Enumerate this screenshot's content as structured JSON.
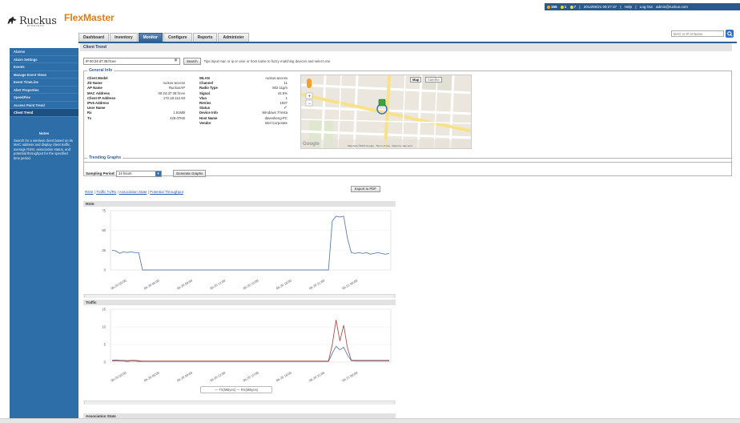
{
  "topbar": {
    "alarm_counts": [
      "155",
      "1",
      "7"
    ],
    "datetime": "2013/06/21 09:27:37",
    "help": "Help",
    "logout": "Log Out",
    "user": "admin@ruckus.com"
  },
  "brand": {
    "logo": "Ruckus",
    "logo_sub": "WIRELESS",
    "product": "FlexMaster"
  },
  "tabs": [
    "Dashboard",
    "Inventory",
    "Monitor",
    "Configure",
    "Reports",
    "Administer"
  ],
  "global_search": {
    "placeholder": "MAC or IP or Name"
  },
  "sidebar": {
    "items": [
      "Alarms",
      "Alarm Settings",
      "Events",
      "Manage Event Views",
      "Event TimeLine",
      "Alert Properties",
      "SpeedFlex",
      "Access Point Trend",
      "Client Trend"
    ],
    "notes_title": "Notes",
    "notes_text": "Search for a wireless client based on its MAC address and display client traffic, average RSSI, association status, and potential throughput for the specified time period."
  },
  "client_trend": {
    "title": "Client Trend",
    "search_value": "IP 00:24:d7:35:f4:ee",
    "search_button": "Search",
    "tips": "Tips:input mac or ip or user or host name to fuzzy matching devices and select one"
  },
  "general_info": {
    "legend": "General Info",
    "left": [
      {
        "k": "Client Model",
        "v": ""
      },
      {
        "k": "ZD Name",
        "v": "ruckus-access"
      },
      {
        "k": "AP Name",
        "v": "RuckusAP"
      },
      {
        "k": "MAC Address",
        "v": "00:24:d7:35:f4:ee"
      },
      {
        "k": "Client IP Address",
        "v": "172.18.112.93"
      },
      {
        "k": "IPv6 Address",
        "v": ""
      },
      {
        "k": "User Name",
        "v": ""
      },
      {
        "k": "Rx",
        "v": "1.51MB"
      },
      {
        "k": "Tx",
        "v": "428.07KB"
      }
    ],
    "right": [
      {
        "k": "WLAN",
        "v": "ruckus-access"
      },
      {
        "k": "Channel",
        "v": "11"
      },
      {
        "k": "Radio Type",
        "v": "802.11g/n"
      },
      {
        "k": "Signal",
        "v": "44.5%"
      },
      {
        "k": "Vlan",
        "v": "1"
      },
      {
        "k": "Retries",
        "v": "1937"
      },
      {
        "k": "Status",
        "v": "✓"
      },
      {
        "k": "Device Info",
        "v": "Windows 7/Vista"
      },
      {
        "k": "Host Name",
        "v": "davesheng-PC"
      },
      {
        "k": "Vendor",
        "v": "Intel Corporate"
      }
    ],
    "map": {
      "map_btn": "Map",
      "sat_btn": "Satellite",
      "google": "Google",
      "attribution": "Map data ©2013 Google · Terms of Use · Report a map error"
    }
  },
  "trending": {
    "legend": "Trending Graphs",
    "sampling_label": "Sampling Period:",
    "sampling_value": "24 hours",
    "generate_button": "Generate Graphs"
  },
  "graph_links": [
    "RSSI",
    "Traffic Tx/Rx",
    "Association State",
    "Potential Throughput"
  ],
  "export_button": "Export to PDF",
  "chart_data": [
    {
      "type": "line",
      "title": "RSSI",
      "ylim": [
        0,
        75
      ],
      "yticks": [
        "75",
        "50",
        "25",
        "0"
      ],
      "x": [
        "06-20 03:00",
        "06-20 06:00",
        "06-20 09:00",
        "06-20 12:00",
        "06-20 15:00",
        "06-20 18:00",
        "06-20 21:00",
        "06-21 00:00"
      ],
      "series": [
        {
          "color": "#5b7fb0",
          "values": [
            25,
            24,
            21,
            23,
            22,
            23,
            22,
            22,
            0,
            0,
            0,
            0,
            0,
            0,
            0,
            0,
            0,
            0,
            0,
            0,
            0,
            0,
            0,
            0,
            0,
            0,
            0,
            0,
            0,
            0,
            0,
            0,
            0,
            0,
            0,
            0,
            0,
            0,
            0,
            0,
            0,
            0,
            0,
            0,
            0,
            0,
            0,
            0,
            0,
            0,
            0,
            0,
            0,
            0,
            0,
            0,
            0,
            0,
            62,
            68,
            67,
            68,
            40,
            22,
            21,
            22,
            21,
            22,
            20,
            21,
            22,
            21,
            20,
            21
          ]
        }
      ]
    },
    {
      "type": "line",
      "title": "Traffic",
      "ylim": [
        0,
        15
      ],
      "yticks": [
        "15",
        "10",
        "5",
        "0"
      ],
      "x": [
        "06-20 03:00",
        "06-20 06:00",
        "06-20 09:00",
        "06-20 12:00",
        "06-20 15:00",
        "06-20 18:00",
        "06-20 21:00",
        "06-21 00:00"
      ],
      "series": [
        {
          "name": "TX(MByes)",
          "color": "#5b7fb0",
          "values": [
            0.3,
            0.4,
            0.3,
            0.3,
            0.2,
            0.3,
            0.3,
            0.2,
            0.2,
            0.2,
            0.2,
            0.2,
            0.2,
            0.2,
            0.2,
            0.2,
            0.2,
            0.2,
            0.2,
            0.2,
            0.2,
            0.2,
            0.2,
            0.2,
            0.2,
            0.2,
            0.2,
            0.2,
            0.2,
            0.2,
            0.2,
            0.2,
            0.2,
            0.2,
            0.2,
            0.2,
            0.2,
            0.2,
            0.2,
            0.2,
            0.2,
            0.2,
            0.2,
            0.2,
            0.2,
            0.2,
            0.2,
            0.2,
            0.2,
            0.2,
            0.2,
            0.2,
            0.2,
            0.2,
            0.2,
            0.2,
            0.2,
            0.2,
            2.5,
            4.5,
            3.5,
            4.2,
            2.0,
            0.4,
            0.3,
            0.3,
            0.3,
            0.3,
            0.3,
            0.3,
            0.3,
            0.3,
            0.3,
            0.3
          ]
        },
        {
          "name": "RX(MByes)",
          "color": "#b0524a",
          "values": [
            0.5,
            0.6,
            0.5,
            0.5,
            0.4,
            0.5,
            0.5,
            0.4,
            0.3,
            0.3,
            0.3,
            0.3,
            0.3,
            0.3,
            0.3,
            0.3,
            0.3,
            0.3,
            0.3,
            0.3,
            0.3,
            0.3,
            0.3,
            0.3,
            0.3,
            0.3,
            0.3,
            0.3,
            0.3,
            0.3,
            0.3,
            0.3,
            0.3,
            0.3,
            0.3,
            0.3,
            0.3,
            0.3,
            0.3,
            0.3,
            0.3,
            0.3,
            0.3,
            0.3,
            0.3,
            0.3,
            0.3,
            0.3,
            0.3,
            0.3,
            0.3,
            0.3,
            0.3,
            0.3,
            0.3,
            0.3,
            0.3,
            0.3,
            5.0,
            12.0,
            6.0,
            10.5,
            4.0,
            0.5,
            0.5,
            0.5,
            0.5,
            0.5,
            0.5,
            0.5,
            0.5,
            0.5,
            0.5,
            0.5
          ]
        }
      ]
    }
  ],
  "assoc_title": "Association State",
  "legend_text": "— TX(MByes) — RX(MByes)"
}
